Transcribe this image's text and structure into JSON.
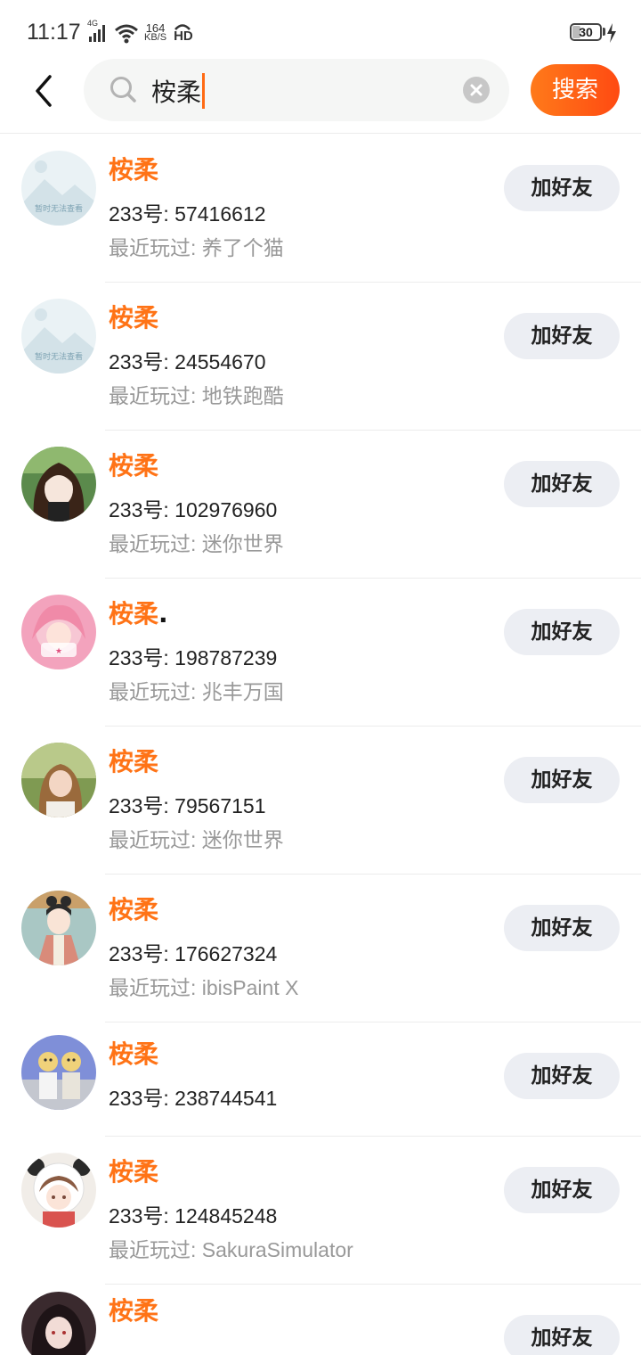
{
  "status_bar": {
    "time": "11:17",
    "network": "4G",
    "speed_value": "164",
    "speed_unit": "KB/S",
    "hd": "HD",
    "battery": "30"
  },
  "search": {
    "query": "桉柔",
    "button_label": "搜索"
  },
  "colors": {
    "accent": "#ff7316",
    "button_bg": "#eceef3"
  },
  "results": [
    {
      "name": "桉柔",
      "id": "233号: 57416612",
      "recent": "最近玩过: 养了个猫",
      "add_label": "加好友",
      "avatar": "placeholder",
      "placeholder_text": "暂时无法查看"
    },
    {
      "name": "桉柔",
      "id": "233号: 24554670",
      "recent": "最近玩过: 地铁跑酷",
      "add_label": "加好友",
      "avatar": "placeholder",
      "placeholder_text": "暂时无法查看"
    },
    {
      "name": "桉柔",
      "id": "233号: 102976960",
      "recent": "最近玩过: 迷你世界",
      "add_label": "加好友",
      "avatar": "anime-dark-hair"
    },
    {
      "name": "桉柔",
      "name_suffix": ".",
      "id": "233号: 198787239",
      "recent": "最近玩过: 兆丰万国",
      "add_label": "加好友",
      "avatar": "anime-pink"
    },
    {
      "name": "桉柔",
      "id": "233号: 79567151",
      "recent": "最近玩过: 迷你世界",
      "add_label": "加好友",
      "avatar": "photo-girl-green"
    },
    {
      "name": "桉柔",
      "id": "233号: 176627324",
      "recent": "最近玩过: ibisPaint X",
      "add_label": "加好友",
      "avatar": "anime-hanfu"
    },
    {
      "name": "桉柔",
      "id": "233号: 238744541",
      "recent": "",
      "add_label": "加好友",
      "avatar": "photo-two-girls"
    },
    {
      "name": "桉柔",
      "id": "233号: 124845248",
      "recent": "最近玩过: SakuraSimulator",
      "add_label": "加好友",
      "avatar": "anime-panda-hood"
    },
    {
      "name": "桉柔",
      "id": "",
      "recent": "",
      "add_label": "加好友",
      "avatar": "anime-long-hair"
    }
  ]
}
